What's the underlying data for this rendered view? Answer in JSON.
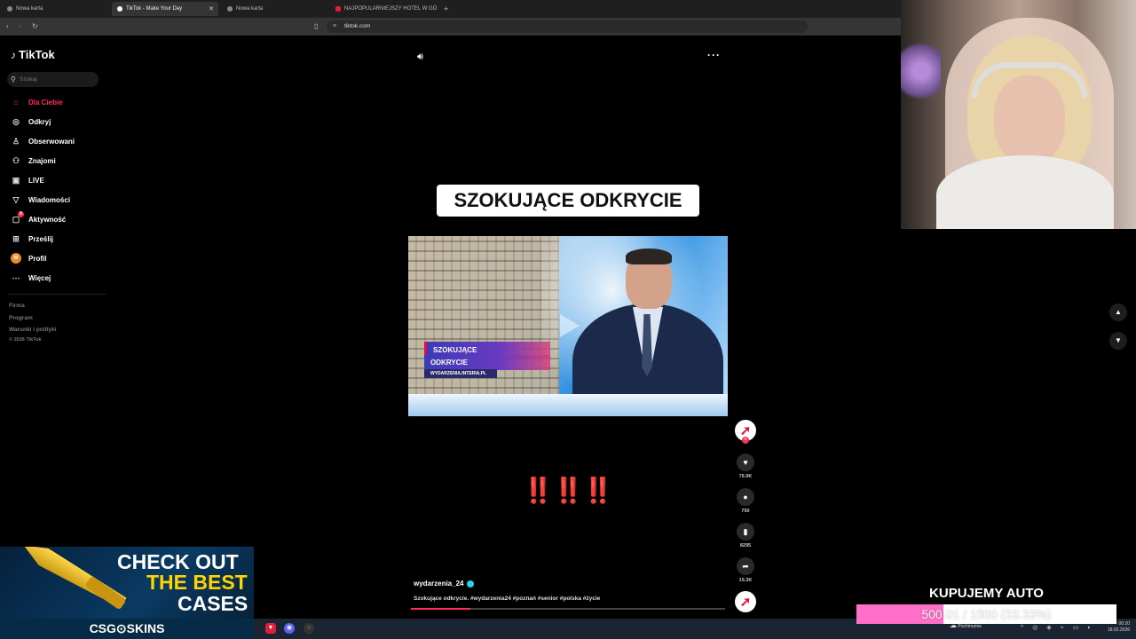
{
  "browser": {
    "tabs": [
      {
        "label": "Nowa karta",
        "active": false
      },
      {
        "label": "TikTok - Make Your Day",
        "active": true
      },
      {
        "label": "Nowa karta",
        "active": false
      },
      {
        "label": "NAJPOPULARNIEJSZY HOTEL W GÓ",
        "active": false
      }
    ],
    "new_tab": "+",
    "url": "tiktok.com"
  },
  "sidebar": {
    "logo": "TikTok",
    "search_placeholder": "Szukaj",
    "items": [
      {
        "label": "Dla Ciebie",
        "icon": "home-icon",
        "active": true
      },
      {
        "label": "Odkryj",
        "icon": "compass-icon",
        "active": false
      },
      {
        "label": "Obserwowani",
        "icon": "following-icon",
        "active": false
      },
      {
        "label": "Znajomi",
        "icon": "friends-icon",
        "active": false
      },
      {
        "label": "LIVE",
        "icon": "live-icon",
        "active": false
      },
      {
        "label": "Wiadomości",
        "icon": "messages-icon",
        "active": false
      },
      {
        "label": "Aktywność",
        "icon": "activity-icon",
        "active": false,
        "badge": "9"
      },
      {
        "label": "Prześlij",
        "icon": "upload-icon",
        "active": false
      },
      {
        "label": "Profil",
        "icon": "profile-icon",
        "active": false,
        "avatar_letter": "W"
      },
      {
        "label": "Więcej",
        "icon": "more-icon",
        "active": false
      }
    ],
    "footer": [
      "Firma",
      "Program",
      "Warunki i polityki",
      "© 2026 TikTok"
    ]
  },
  "video": {
    "headline": "SZOKUJĄCE ODKRYCIE",
    "lower_third_1": "SZOKUJĄCE",
    "lower_third_2": "ODKRYCIE",
    "lower_third_3": "WYDARZENIA.INTERIA.PL",
    "exclamations": "‼️‼️‼️",
    "author": "wydarzenia_24",
    "caption": "Szokujące odkrycie. #wydarzenia24 #poznań #senior #polska #życie",
    "progress": 0.19
  },
  "actions": {
    "likes": "76.9K",
    "comments": "750",
    "saves": "8295",
    "shares": "15.3K"
  },
  "stream_overlay": {
    "goal_title": "KUPUJEMY AUTO",
    "goal_text": "500.01 / 1500 (33.33%)",
    "goal_fraction": 0.3333,
    "ad_line1": "CHECK OUT",
    "ad_line2": "THE BEST",
    "ad_line3": "CASES",
    "ad_brand": "CSG⊙SKINS"
  },
  "taskbar": {
    "weather": "Pochmurnie",
    "time": "00:20",
    "date": "18.02.2026"
  },
  "colors": {
    "accent": "#fe2c55",
    "goal_fill": "#ff6ec7",
    "verified": "#20d5ec"
  }
}
